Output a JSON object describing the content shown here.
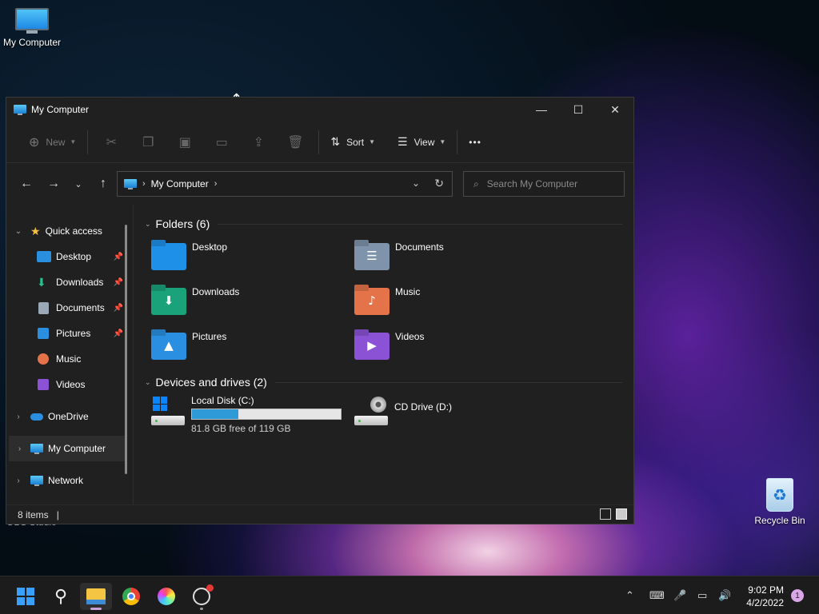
{
  "desktop": {
    "icons": [
      {
        "label": "My Computer"
      },
      {
        "label": "Recycle Bin"
      },
      {
        "label": "OBS Studio"
      }
    ]
  },
  "window": {
    "title": "My Computer",
    "controls": {
      "minimize": "—",
      "maximize": "☐",
      "close": "✕"
    }
  },
  "toolbar": {
    "new_label": "New",
    "sort_label": "Sort",
    "view_label": "View",
    "more_label": "•••"
  },
  "address": {
    "location": "My Computer",
    "search_placeholder": "Search My Computer"
  },
  "nav": {
    "quick_access": "Quick access",
    "items": [
      {
        "label": "Desktop",
        "icon": "desktop-icon",
        "pinned": true
      },
      {
        "label": "Downloads",
        "icon": "downloads-icon",
        "pinned": true
      },
      {
        "label": "Documents",
        "icon": "documents-icon",
        "pinned": true
      },
      {
        "label": "Pictures",
        "icon": "pictures-icon",
        "pinned": true
      },
      {
        "label": "Music",
        "icon": "music-icon",
        "pinned": false
      },
      {
        "label": "Videos",
        "icon": "videos-icon",
        "pinned": false
      }
    ],
    "onedrive": "OneDrive",
    "my_computer": "My Computer",
    "network": "Network"
  },
  "content": {
    "folders_header": "Folders (6)",
    "folders": [
      {
        "name": "Desktop",
        "color": "#1e90e8",
        "glyph": ""
      },
      {
        "name": "Documents",
        "color": "#7f93ab",
        "glyph": "☰"
      },
      {
        "name": "Downloads",
        "color": "#1aa27a",
        "glyph": "⬇"
      },
      {
        "name": "Music",
        "color": "#e5734a",
        "glyph": "♪"
      },
      {
        "name": "Pictures",
        "color": "#2a8fe0",
        "glyph": "▲"
      },
      {
        "name": "Videos",
        "color": "#8b52d6",
        "glyph": "▶"
      }
    ],
    "drives_header": "Devices and drives (2)",
    "drives": [
      {
        "name": "Local Disk (C:)",
        "free": "81.8 GB free of 119 GB",
        "used_fraction": 0.31
      },
      {
        "name": "CD Drive (D:)"
      }
    ]
  },
  "status": {
    "items_count": "8 items"
  },
  "taskbar": {
    "time": "9:02 PM",
    "date": "4/2/2022",
    "notifications": "1"
  },
  "colors": {
    "accent": "#2f9ad8",
    "window_bg": "#202020",
    "taskbar_bg": "#1c1c1c"
  }
}
